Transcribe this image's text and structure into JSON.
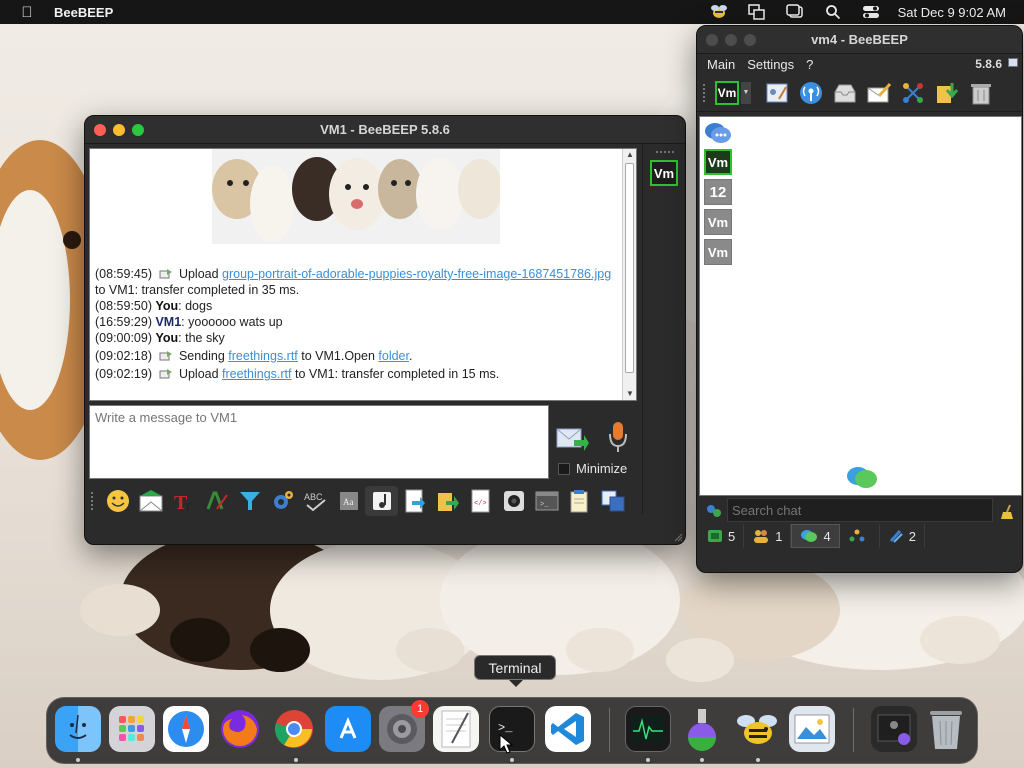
{
  "menubar": {
    "app_name": "BeeBEEP",
    "clock": "Sat Dec 9  9:02 AM"
  },
  "vm1_window": {
    "title": "VM1 - BeeBEEP 5.8.6",
    "messages": [
      {
        "time": "(08:59:45)",
        "kind": "upload",
        "pre": " Upload ",
        "link": "group-portrait-of-adorable-puppies-royalty-free-image-1687451786.jpg",
        "post": " to VM1: transfer completed in 35 ms."
      },
      {
        "time": "(08:59:50)",
        "kind": "chat",
        "sender": "You",
        "text": ": dogs"
      },
      {
        "time": "(16:59:29)",
        "kind": "chat",
        "sender": "VM1",
        "text": ": yoooooo wats up"
      },
      {
        "time": "(09:00:09)",
        "kind": "chat",
        "sender": "You",
        "text": ": the sky"
      },
      {
        "time": "(09:02:18)",
        "kind": "sending",
        "pre": " Sending ",
        "link": "freethings.rtf",
        "mid": " to VM1.Open ",
        "link2": "folder",
        "post": "."
      },
      {
        "time": "(09:02:19)",
        "kind": "upload",
        "pre": " Upload ",
        "link": "freethings.rtf",
        "post": " to VM1: transfer completed in 15 ms."
      }
    ],
    "input_placeholder": "Write a message to VM1",
    "minimize_label": "Minimize",
    "side_badge": "Vm"
  },
  "vm4_window": {
    "title": "vm4 - BeeBEEP",
    "menu": [
      "Main",
      "Settings",
      "?"
    ],
    "version": "5.8.6",
    "status_badge": "Vm",
    "users": [
      {
        "label": "Vm",
        "selected": true
      },
      {
        "label": "12",
        "selected": false
      },
      {
        "label": "Vm",
        "selected": false
      },
      {
        "label": "Vm",
        "selected": false
      }
    ],
    "search_placeholder": "Search chat",
    "tabs": [
      {
        "count": "5",
        "icon": "users-online-icon"
      },
      {
        "count": "1",
        "icon": "groups-icon"
      },
      {
        "count": "4",
        "icon": "chats-icon",
        "active": true
      },
      {
        "count": "",
        "icon": "shares-icon"
      },
      {
        "count": "2",
        "icon": "files-icon"
      }
    ]
  },
  "dock": {
    "tooltip": "Terminal",
    "settings_badge": "1",
    "apps": [
      "Finder",
      "Launchpad",
      "Safari",
      "Firefox",
      "Chrome",
      "App Store",
      "System Settings",
      "TextEdit",
      "Terminal",
      "Visual Studio Code",
      "Activity Monitor",
      "Disk Utility",
      "BeeBEEP",
      "Preview",
      "Downloads",
      "Trash"
    ]
  },
  "colors": {
    "accent_green": "#2ec02e",
    "link_blue": "#3a8fd8",
    "window_bg": "#2b2b2b"
  }
}
